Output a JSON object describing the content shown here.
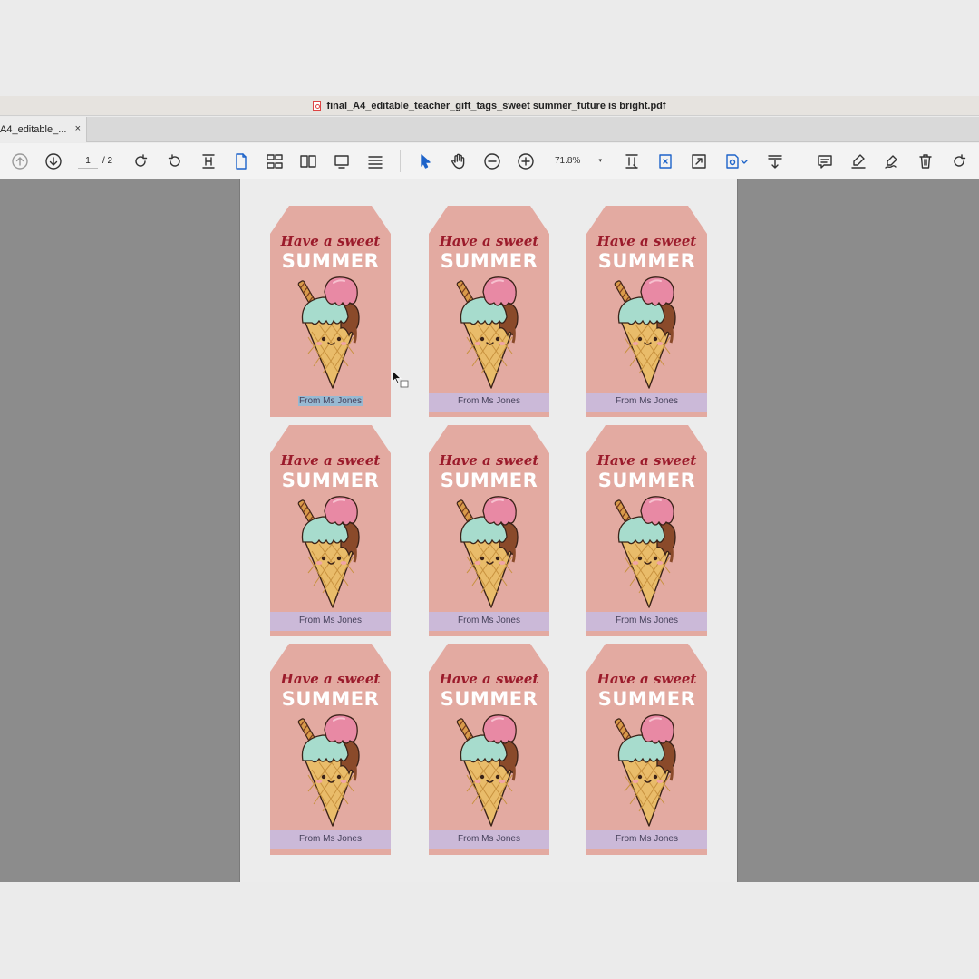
{
  "window": {
    "title": "final_A4_editable_teacher_gift_tags_sweet summer_future is bright.pdf"
  },
  "tab": {
    "label": "A4_editable_...",
    "close": "×"
  },
  "toolbar": {
    "page_current": "1",
    "page_total": "/ 2",
    "zoom": "71.8%",
    "zoom_caret": "▾",
    "icons": [
      "previous-page-icon",
      "next-page-icon",
      "rotate-clockwise-icon",
      "rotate-counterclockwise-icon",
      "fit-width-icon",
      "single-page-icon",
      "two-page-icon",
      "book-view-icon",
      "presentation-icon",
      "scroll-icon",
      "select-arrow-icon",
      "hand-tool-icon",
      "zoom-out-icon",
      "zoom-in-icon",
      "crop-icon",
      "rectangle-select-icon",
      "fullscreen-icon",
      "redact-icon",
      "extract-icon",
      "comment-icon",
      "highlight-icon",
      "signature-icon",
      "trash-icon",
      "undo-icon"
    ]
  },
  "tags": [
    {
      "line1": "Have a sweet",
      "line2": "SUMMER",
      "from": "From Ms Jones"
    },
    {
      "line1": "Have a sweet",
      "line2": "SUMMER",
      "from": "From Ms Jones"
    },
    {
      "line1": "Have a sweet",
      "line2": "SUMMER",
      "from": "From Ms Jones"
    },
    {
      "line1": "Have a sweet",
      "line2": "SUMMER",
      "from": "From Ms Jones"
    },
    {
      "line1": "Have a sweet",
      "line2": "SUMMER",
      "from": "From Ms Jones"
    },
    {
      "line1": "Have a sweet",
      "line2": "SUMMER",
      "from": "From Ms Jones"
    },
    {
      "line1": "Have a sweet",
      "line2": "SUMMER",
      "from": "From Ms Jones"
    },
    {
      "line1": "Have a sweet",
      "line2": "SUMMER",
      "from": "From Ms Jones"
    },
    {
      "line1": "Have a sweet",
      "line2": "SUMMER",
      "from": "From Ms Jones"
    }
  ],
  "colors": {
    "tag_bg": "#e3aaa1",
    "title_red": "#9b1b2b",
    "band_lavender": "#cbb9d8",
    "selection_blue": "#97b9d2",
    "accent_blue": "#1d63c9"
  }
}
